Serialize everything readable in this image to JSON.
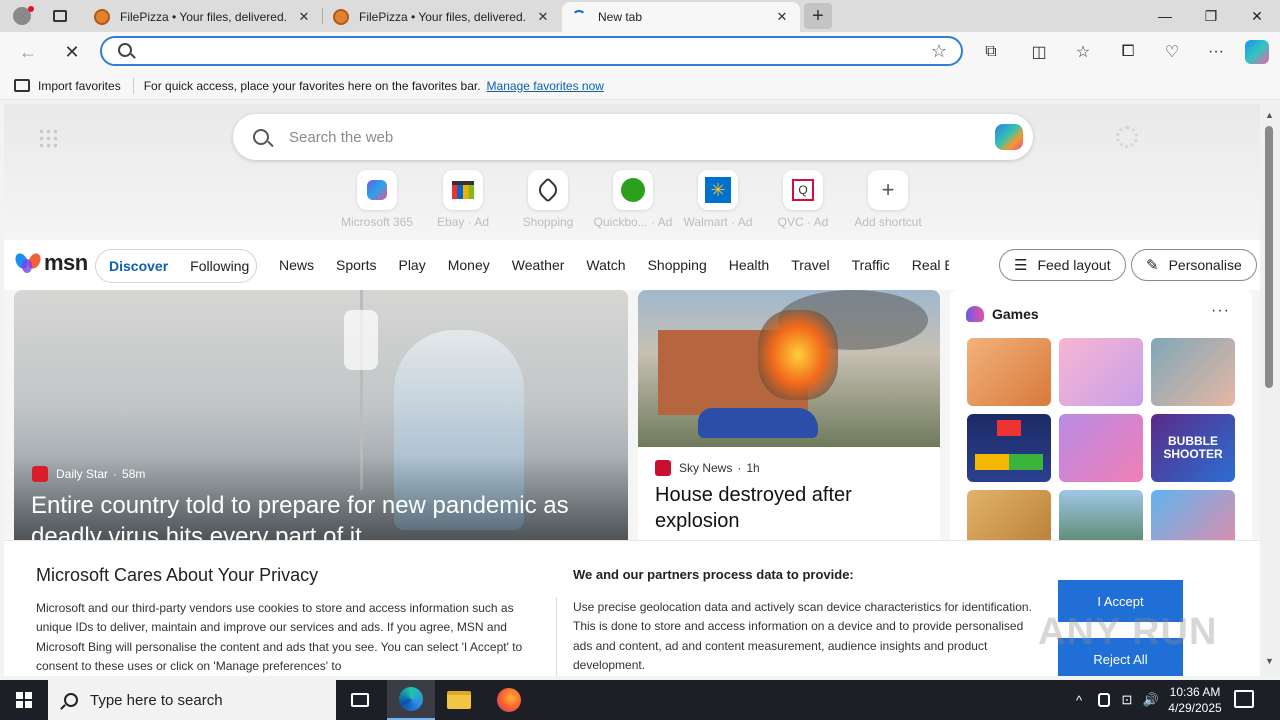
{
  "browser": {
    "tabs": [
      {
        "title": "FilePizza • Your files, delivered.",
        "active": false
      },
      {
        "title": "FilePizza • Your files, delivered.",
        "active": false
      },
      {
        "title": "New tab",
        "active": true
      }
    ],
    "close_tab_glyph": "✕",
    "new_tab_glyph": "+",
    "window_controls": {
      "minimize": "—",
      "restore": "❐",
      "close": "✕"
    },
    "nav": {
      "back": "←",
      "stop": "✕"
    },
    "address_value": "",
    "favorite_star": "☆",
    "toolbar_icons": [
      "extensions-icon",
      "split-screen-icon",
      "favorites-icon",
      "collections-icon",
      "browser-essentials-icon",
      "more-icon",
      "copilot-icon"
    ],
    "toolbar_glyphs": {
      "extensions": "⧉",
      "split": "◫",
      "favorites": "☆",
      "collections": "⧠",
      "essentials": "♡",
      "more": "···"
    }
  },
  "favorites_bar": {
    "import_label": "Import favorites",
    "hint": "For quick access, place your favorites here on the favorites bar.",
    "manage_link": "Manage favorites now"
  },
  "new_tab": {
    "search_placeholder": "Search the web",
    "shortcuts": [
      {
        "label": "Microsoft 365",
        "icon": "microsoft-365-icon"
      },
      {
        "label": "Ebay · Ad",
        "icon": "ebay-icon"
      },
      {
        "label": "Shopping",
        "icon": "shopping-tag-icon"
      },
      {
        "label": "Quickbo... · Ad",
        "icon": "quickbooks-icon"
      },
      {
        "label": "Walmart · Ad",
        "icon": "walmart-icon"
      },
      {
        "label": "QVC · Ad",
        "icon": "qvc-icon"
      },
      {
        "label": "Add shortcut",
        "icon": "plus-icon"
      }
    ],
    "add_glyph": "+"
  },
  "msn": {
    "logo": "msn",
    "feed_toggle": {
      "discover": "Discover",
      "following": "Following"
    },
    "nav_links": [
      "News",
      "Sports",
      "Play",
      "Money",
      "Weather",
      "Watch",
      "Shopping",
      "Health",
      "Travel",
      "Traffic",
      "Real E"
    ],
    "feed_layout": "Feed layout",
    "personalise": "Personalise",
    "feed_layout_glyph": "☰",
    "personalise_glyph": "✎"
  },
  "cards": {
    "main": {
      "source": "Daily Star",
      "age": "58m",
      "headline": "Entire country told to prepare for new pandemic as deadly virus hits every part of it"
    },
    "second": {
      "source": "Sky News",
      "age": "1h",
      "headline": "House destroyed after explosion"
    },
    "games": {
      "title": "Games",
      "more": "···",
      "bubble_text": "BUBBLE SHOOTER"
    }
  },
  "privacy": {
    "title": "Microsoft Cares About Your Privacy",
    "body": "Microsoft and our third-party vendors use cookies to store and access information such as unique IDs to deliver, maintain and improve our services and ads. If you agree, MSN and Microsoft Bing will personalise the content and ads that you see. You can select 'I Accept' to consent to these uses or click on 'Manage preferences' to",
    "partners_heading": "We and our partners process data to provide:",
    "partners_body": "Use precise geolocation data and actively scan device characteristics for identification. This is done to store and access information on a device and to provide personalised ads and content, ad and content measurement, audience insights and product development.",
    "accept": "I Accept",
    "reject": "Reject All",
    "watermark": "ANY RUN"
  },
  "taskbar": {
    "search_placeholder": "Type here to search",
    "time": "10:36 AM",
    "date": "4/29/2025",
    "tray": {
      "chevron": "^",
      "network": "⊡",
      "volume": "🔊"
    }
  },
  "colors": {
    "accent": "#1f6fd6",
    "msn_link": "#0e5fb4",
    "taskbar": "#1c1f26"
  }
}
